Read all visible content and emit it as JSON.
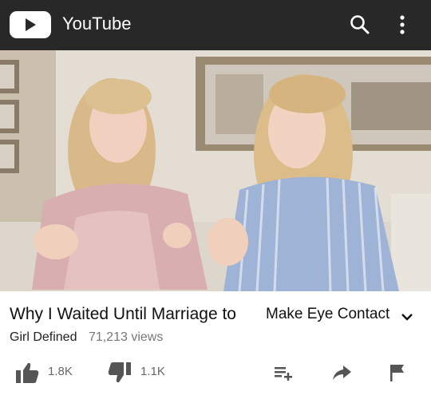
{
  "header": {
    "app_title": "YouTube",
    "icons": [
      "youtube-logo-icon",
      "search-icon",
      "more-vert-icon"
    ]
  },
  "video": {
    "title": "Why I Waited Until Marriage to",
    "title_annotation": "Make Eye Contact",
    "channel": "Girl Defined",
    "views": "71,213 views"
  },
  "actions": {
    "likes": "1.8K",
    "dislikes": "1.1K",
    "icons": [
      "thumb-up-icon",
      "thumb-down-icon",
      "add-to-playlist-icon",
      "share-icon",
      "flag-icon"
    ]
  },
  "colors": {
    "header_bg": "#282828",
    "icon_gray": "#555555",
    "count_gray": "#666666"
  }
}
